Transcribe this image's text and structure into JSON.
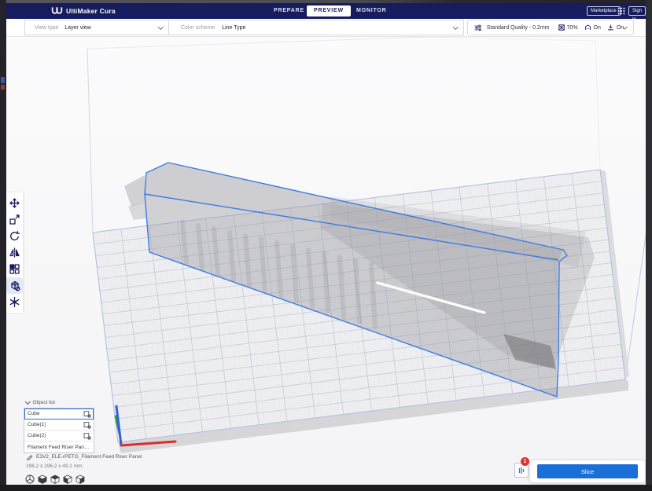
{
  "app": {
    "name": "UltiMaker Cura"
  },
  "header": {
    "logo_text": "UltiMaker Cura",
    "tabs": [
      {
        "label": "PREPARE"
      },
      {
        "label": "PREVIEW"
      },
      {
        "label": "MONITOR"
      }
    ],
    "active_tab": "PREVIEW",
    "marketplace_label": "Marketplace",
    "apps_icon": "grid-apps-icon",
    "sign_in_label": "Sign in"
  },
  "toolbar": {
    "view_type": {
      "label": "View type",
      "value": "Layer view"
    },
    "color_scheme": {
      "label": "Color scheme",
      "value": "Line Type"
    },
    "print_settings": {
      "icon": "sliders-icon",
      "profile": "Standard Quality - 0.2mm",
      "items": [
        {
          "icon": "infill-icon",
          "value": "70%"
        },
        {
          "icon": "support-icon",
          "value": "On"
        },
        {
          "icon": "adhesion-icon",
          "value": "On"
        }
      ]
    }
  },
  "tools": [
    {
      "name": "move-tool"
    },
    {
      "name": "scale-tool"
    },
    {
      "name": "rotate-tool"
    },
    {
      "name": "mirror-tool"
    },
    {
      "name": "per-model-settings-tool"
    },
    {
      "name": "support-blocker-tool",
      "active": true
    },
    {
      "name": "custom-supports-tool"
    }
  ],
  "object_list": {
    "header": "Object list",
    "items": [
      {
        "name": "Cube",
        "selected": true,
        "mesh_icon": "modifier-mesh-icon"
      },
      {
        "name": "Cube(1)",
        "selected": false,
        "mesh_icon": "modifier-mesh-icon"
      },
      {
        "name": "Cube(2)",
        "selected": false,
        "mesh_icon": "modifier-mesh-icon"
      },
      {
        "name": "Filament Feed Riser Panel.stl",
        "selected": false,
        "mesh_icon": null
      }
    ]
  },
  "project": {
    "name": "E3V2_ELE-rPETG_Filament Feed Riser Panel",
    "dimensions": "196.2 x 196.2 x 49.1 mm"
  },
  "view_presets": [
    "3d-view",
    "front-view",
    "top-view",
    "left-view",
    "right-view"
  ],
  "slice_panel": {
    "button_label": "Slice",
    "badge_count": "1",
    "warn_icon": "sliders-vertical-icon"
  },
  "colors": {
    "header_bg": "#161c5e",
    "accent_blue": "#2b6be0",
    "slice_button": "#1a6fd6",
    "selection_outline": "#3b7ce0",
    "badge_red": "#e0312f",
    "axis_x": "#da2e2e",
    "axis_y": "#3aa33a",
    "axis_z": "#2f62d8"
  }
}
